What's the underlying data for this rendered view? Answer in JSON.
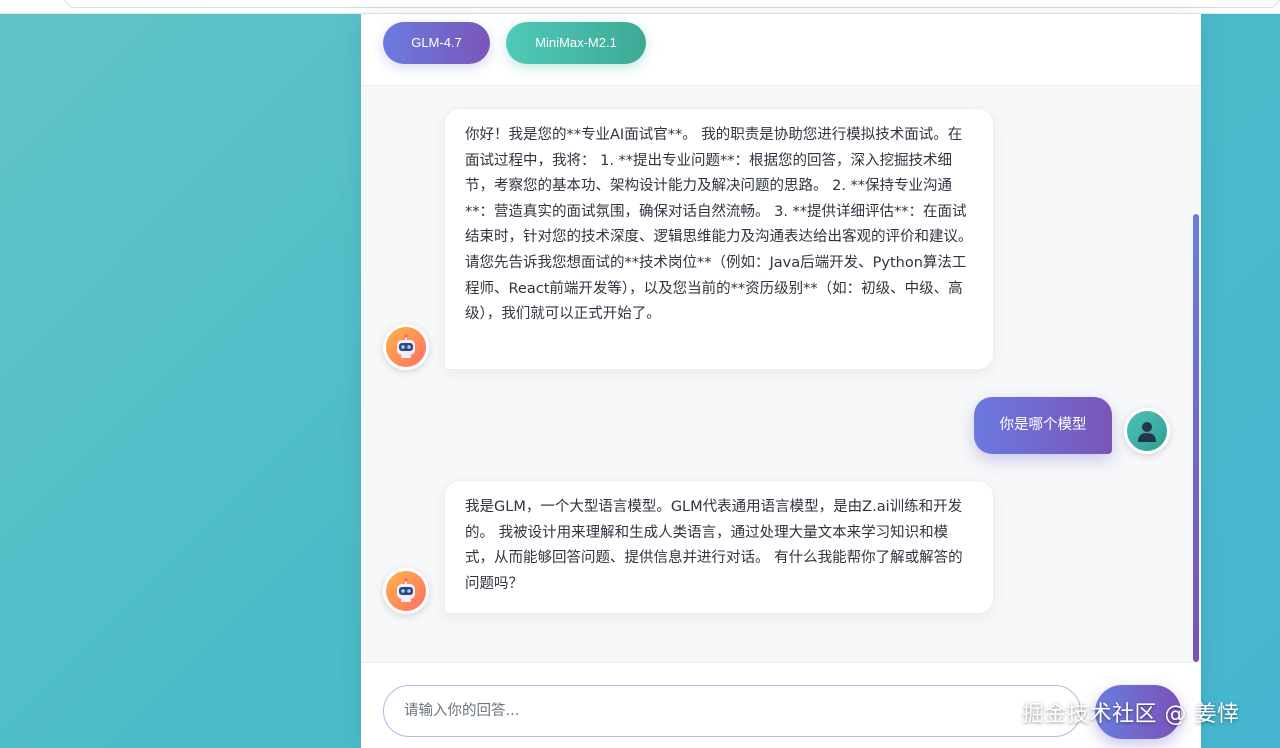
{
  "models": [
    {
      "label": "GLM-4.7"
    },
    {
      "label": "MiniMax-M2.1"
    }
  ],
  "messages": [
    {
      "role": "bot",
      "text": "你好！我是您的**专业AI面试官**。 我的职责是协助您进行模拟技术面试。在面试过程中，我将： 1. **提出专业问题**：根据您的回答，深入挖掘技术细节，考察您的基本功、架构设计能力及解决问题的思路。 2. **保持专业沟通**：营造真实的面试氛围，确保对话自然流畅。 3. **提供详细评估**：在面试结束时，针对您的技术深度、逻辑思维能力及沟通表达给出客观的评价和建议。 请您先告诉我您想面试的**技术岗位**（例如：Java后端开发、Python算法工程师、React前端开发等），以及您当前的**资历级别**（如：初级、中级、高级），我们就可以正式开始了。"
    },
    {
      "role": "user",
      "text": "你是哪个模型"
    },
    {
      "role": "bot",
      "text": "我是GLM，一个大型语言模型。GLM代表通用语言模型，是由Z.ai训练和开发的。 我被设计用来理解和生成人类语言，通过处理大量文本来学习知识和模式，从而能够回答问题、提供信息并进行对话。 有什么我能帮你了解或解答的问题吗？"
    }
  ],
  "input": {
    "placeholder": "请输入你的回答..."
  },
  "watermark": "掘金技术社区 @ 姜悻",
  "icons": {
    "bot_avatar": "robot-icon",
    "user_avatar": "user-icon",
    "send": "send-icon"
  },
  "colors": {
    "accent_from": "#6b7be0",
    "accent_to": "#7b55b8",
    "teal_from": "#4fcab8",
    "teal_to": "#3ea995",
    "background": "#4cbcc8"
  }
}
